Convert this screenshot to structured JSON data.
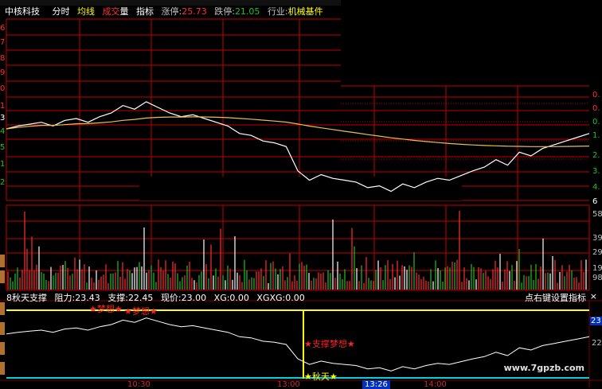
{
  "toolbar": {
    "stock_name": "中核科技",
    "tab_intraday": "分时",
    "tab_avg": "均线",
    "tab_vol_a": "成交",
    "tab_vol_b": "量",
    "tab_indicator": "指标",
    "limit_up_label": "涨停:",
    "limit_up_value": "25.73",
    "limit_down_label": "跌停:",
    "limit_down_value": "21.05",
    "industry_label": "行业:",
    "industry_value": "机械基件"
  },
  "left_axis": [
    "6",
    "7",
    "8",
    "9",
    "0",
    "1",
    "3",
    "4",
    "5",
    "1",
    "2"
  ],
  "right_axis_price": [
    "0.",
    "0.",
    "0.",
    "1.",
    "2.",
    "3.",
    "4.",
    "6"
  ],
  "right_axis_volume": [
    "58",
    "39",
    "29",
    "19",
    "98"
  ],
  "indicator": {
    "name": "8秋天支撑",
    "resistance_label": "阻力:",
    "resistance_value": "23.43",
    "support_label": "支撑:",
    "support_value": "22.45",
    "price_label": "现价:",
    "price_value": "23.00",
    "xg_label": "XG:",
    "xg_value": "0.00",
    "xgxg_label": "XGXG:",
    "xgxg_value": "0.00",
    "hint": "点右键设置指标",
    "close": "×",
    "right_scale_top": "23",
    "right_scale_mid": "22"
  },
  "annotations": {
    "dream_a": "★梦想★",
    "dream_b": "★梦想★",
    "support_dream": "★支撑梦想★",
    "autumn": "★秋天★"
  },
  "time_axis": {
    "t1": "10:30",
    "t2": "13:00",
    "current": "13:26",
    "t3": "14:00"
  },
  "watermark": "www.7gpzb.com",
  "colors": {
    "grid": "#c00000",
    "price_line": "#ffffff",
    "avg_line": "#e8c050",
    "vol_up": "#ff3030",
    "vol_down": "#20c020",
    "vol_neutral": "#ffffff",
    "resistance_line": "#ffff00",
    "support_line": "#00d0e0"
  },
  "chart_data": {
    "type": "line",
    "series": [
      {
        "name": "",
        "values": [
          23.05,
          23.08,
          23.1,
          23.12,
          23.08,
          23.14,
          23.16,
          23.12,
          23.18,
          23.22,
          23.3,
          23.26,
          23.34,
          23.28,
          23.22,
          23.18,
          23.2,
          23.16,
          23.12,
          23.08,
          23.0,
          22.98,
          22.92,
          22.9,
          22.86,
          22.6,
          22.5,
          22.56,
          22.52,
          22.5,
          22.48,
          22.42,
          22.44,
          22.38,
          22.46,
          22.42,
          22.48,
          22.52,
          22.5,
          22.55,
          22.6,
          22.64,
          22.72,
          22.66,
          22.8,
          22.76,
          22.84,
          22.88,
          22.92,
          22.96,
          23.0
        ]
      }
    ]
  }
}
